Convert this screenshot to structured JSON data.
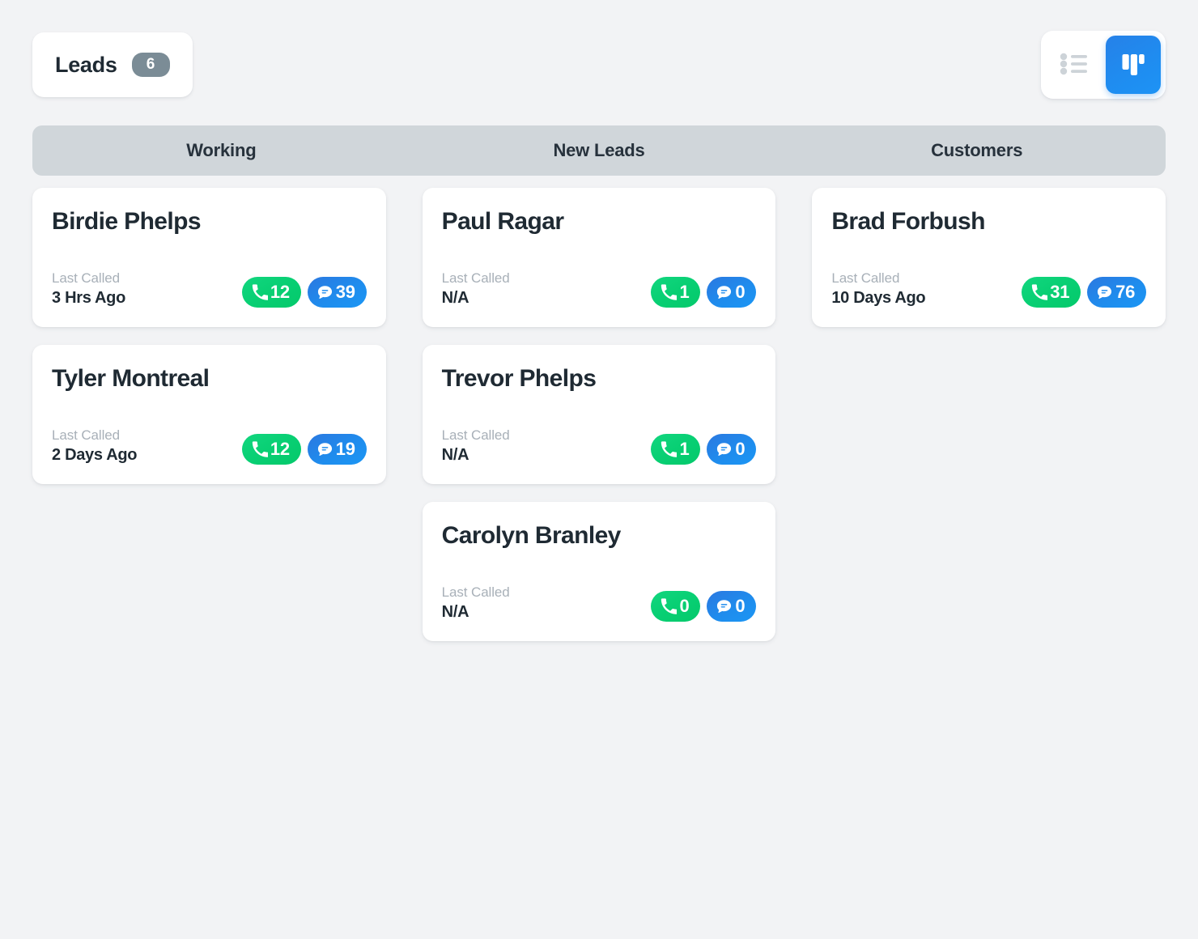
{
  "header": {
    "title": "Leads",
    "count": "6",
    "view_toggle": {
      "list_icon": "list-icon",
      "board_icon": "board-icon",
      "active": "board"
    }
  },
  "columns": [
    {
      "name": "Working",
      "cards": [
        {
          "name": "Birdie Phelps",
          "last_called_label": "Last Called",
          "last_called_value": "3 Hrs Ago",
          "calls": "12",
          "messages": "39"
        },
        {
          "name": "Tyler Montreal",
          "last_called_label": "Last Called",
          "last_called_value": "2 Days Ago",
          "calls": "12",
          "messages": "19"
        }
      ]
    },
    {
      "name": "New Leads",
      "cards": [
        {
          "name": "Paul Ragar",
          "last_called_label": "Last Called",
          "last_called_value": "N/A",
          "calls": "1",
          "messages": "0"
        },
        {
          "name": "Trevor Phelps",
          "last_called_label": "Last Called",
          "last_called_value": "N/A",
          "calls": "1",
          "messages": "0"
        },
        {
          "name": "Carolyn Branley",
          "last_called_label": "Last Called",
          "last_called_value": "N/A",
          "calls": "0",
          "messages": "0"
        }
      ]
    },
    {
      "name": "Customers",
      "cards": [
        {
          "name": "Brad Forbush",
          "last_called_label": "Last Called",
          "last_called_value": "10 Days Ago",
          "calls": "31",
          "messages": "76"
        }
      ]
    }
  ],
  "colors": {
    "page_background": "#f2f3f5",
    "column_header_background": "#d0d6da",
    "card_background": "#ffffff",
    "text_primary": "#1f2a33",
    "text_muted": "#a8b0b8",
    "count_badge": "#7b8c96",
    "call_badge": "#08cf73",
    "message_badge": "#1f8ced",
    "toggle_active": "#1f8cf0"
  }
}
